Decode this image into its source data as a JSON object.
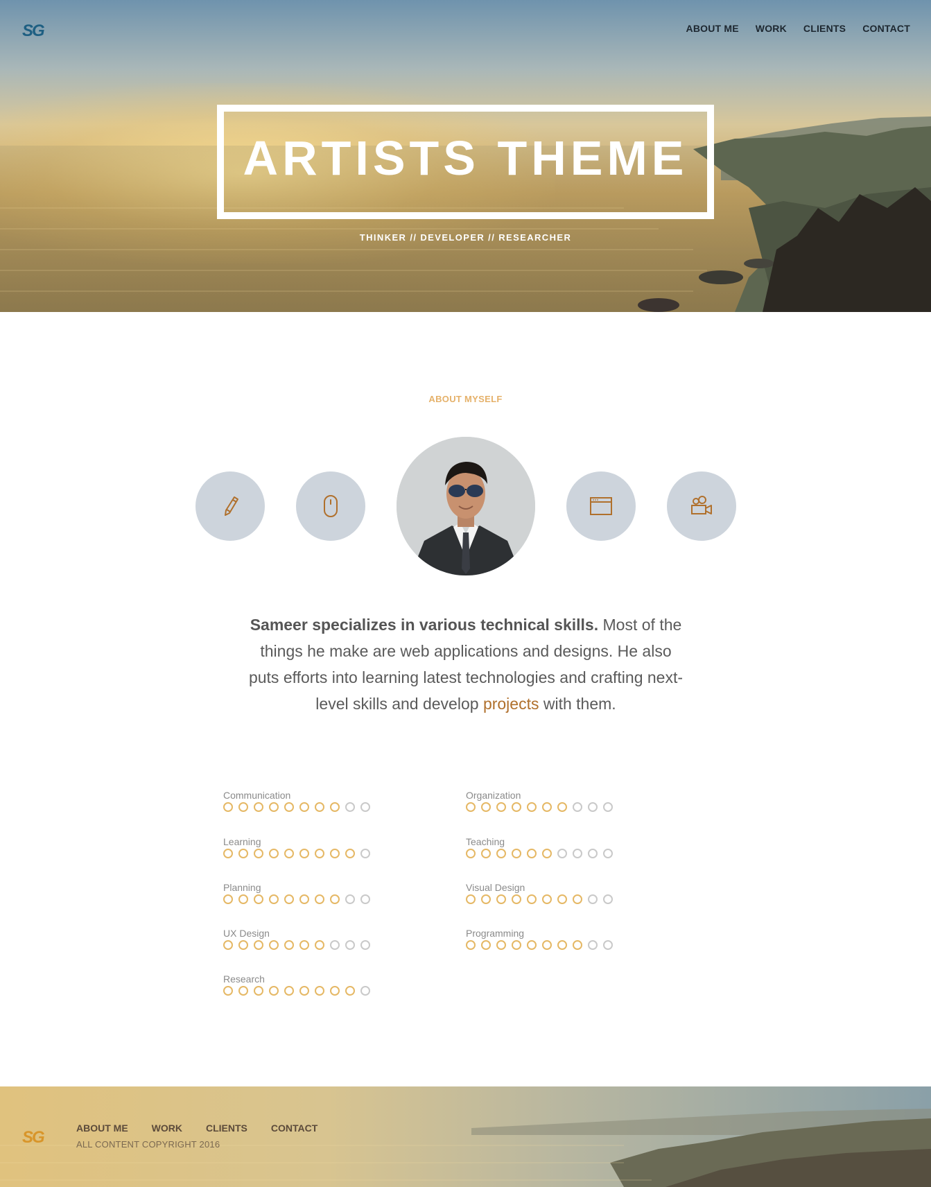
{
  "brand": {
    "logo_text": "SG"
  },
  "nav": [
    {
      "label": "ABOUT ME"
    },
    {
      "label": "WORK"
    },
    {
      "label": "CLIENTS"
    },
    {
      "label": "CONTACT"
    }
  ],
  "hero": {
    "title": "ARTISTS THEME",
    "subtitle": "THINKER // DEVELOPER // RESEARCHER"
  },
  "about": {
    "kicker": "ABOUT MYSELF",
    "icons": [
      "pencil-icon",
      "mouse-icon",
      "browser-window-icon",
      "video-camera-icon"
    ],
    "text_strong": "Sameer specializes in various technical skills.",
    "text_body": " Most of the things he make are web applications and designs. He also puts efforts into learning latest technologies and crafting next-level skills and develop ",
    "text_link": "projects",
    "text_end": " with them."
  },
  "skills": {
    "max": 10,
    "left": [
      {
        "name": "Communication",
        "level": 8
      },
      {
        "name": "Learning",
        "level": 9
      },
      {
        "name": "Planning",
        "level": 8
      },
      {
        "name": "UX Design",
        "level": 7
      },
      {
        "name": "Research",
        "level": 9
      }
    ],
    "right": [
      {
        "name": "Organization",
        "level": 7
      },
      {
        "name": "Teaching",
        "level": 6
      },
      {
        "name": "Visual Design",
        "level": 8
      },
      {
        "name": "Programming",
        "level": 8
      }
    ]
  },
  "footer": {
    "nav": [
      {
        "label": "ABOUT ME"
      },
      {
        "label": "WORK"
      },
      {
        "label": "CLIENTS"
      },
      {
        "label": "CONTACT"
      }
    ],
    "copyright": "ALL CONTENT COPYRIGHT 2016"
  },
  "colors": {
    "accent": "#e5b865",
    "link": "#b0702c",
    "icon_bg": "#cdd4dc",
    "icon_stroke": "#b0702c",
    "dot_off": "#c9c9c9"
  }
}
